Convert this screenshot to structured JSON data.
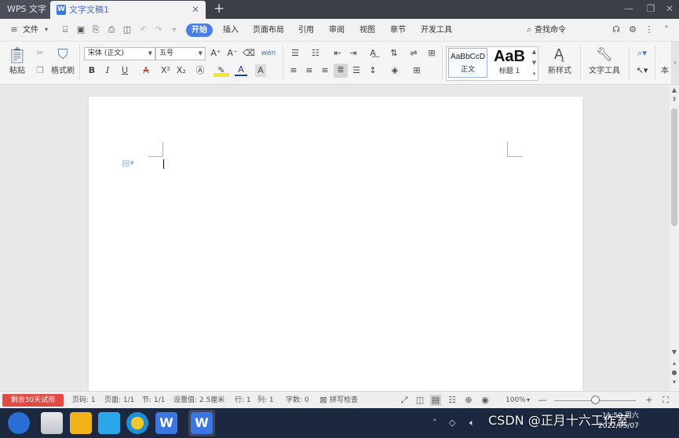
{
  "titlebar": {
    "app_name": "WPS 文字",
    "doc_tab": "文字文稿1",
    "close_glyph": "✕",
    "new_tab_glyph": "+",
    "minimize": "—",
    "restore": "❐",
    "close_window": "✕"
  },
  "menubar": {
    "file": "文件",
    "tabs": [
      "开始",
      "插入",
      "页面布局",
      "引用",
      "审阅",
      "视图",
      "章节",
      "开发工具"
    ],
    "active_tab": "开始",
    "search": "查找命令"
  },
  "ribbon": {
    "paste": "粘贴",
    "format_painter": "格式刷",
    "font_name": "宋体 (正文)",
    "font_size": "五号",
    "style_normal_preview": "AaBbCcD",
    "style_normal": "正文",
    "style_h1_preview": "AaB",
    "style_h1": "标题 1",
    "new_style": "新样式",
    "text_tools": "文字工具",
    "more": "本"
  },
  "statusbar": {
    "trial": "剩余30天试用",
    "page_no": "页码: 1",
    "pages": "页面: 1/1",
    "section": "节: 1/1",
    "setting": "设置值: 2.5厘米",
    "row": "行: 1",
    "col": "列: 1",
    "words": "字数: 0",
    "spell": "拼写检查",
    "zoom": "100%"
  },
  "taskbar": {
    "watermark": "CSDN @正月十六工作室",
    "time": "11:50 周六",
    "date": "2022/05/07"
  },
  "colors": {
    "accent": "#4a7ee6",
    "trial": "#e04a43",
    "titlebar": "#3b4048",
    "taskbar": "#1c2740"
  }
}
